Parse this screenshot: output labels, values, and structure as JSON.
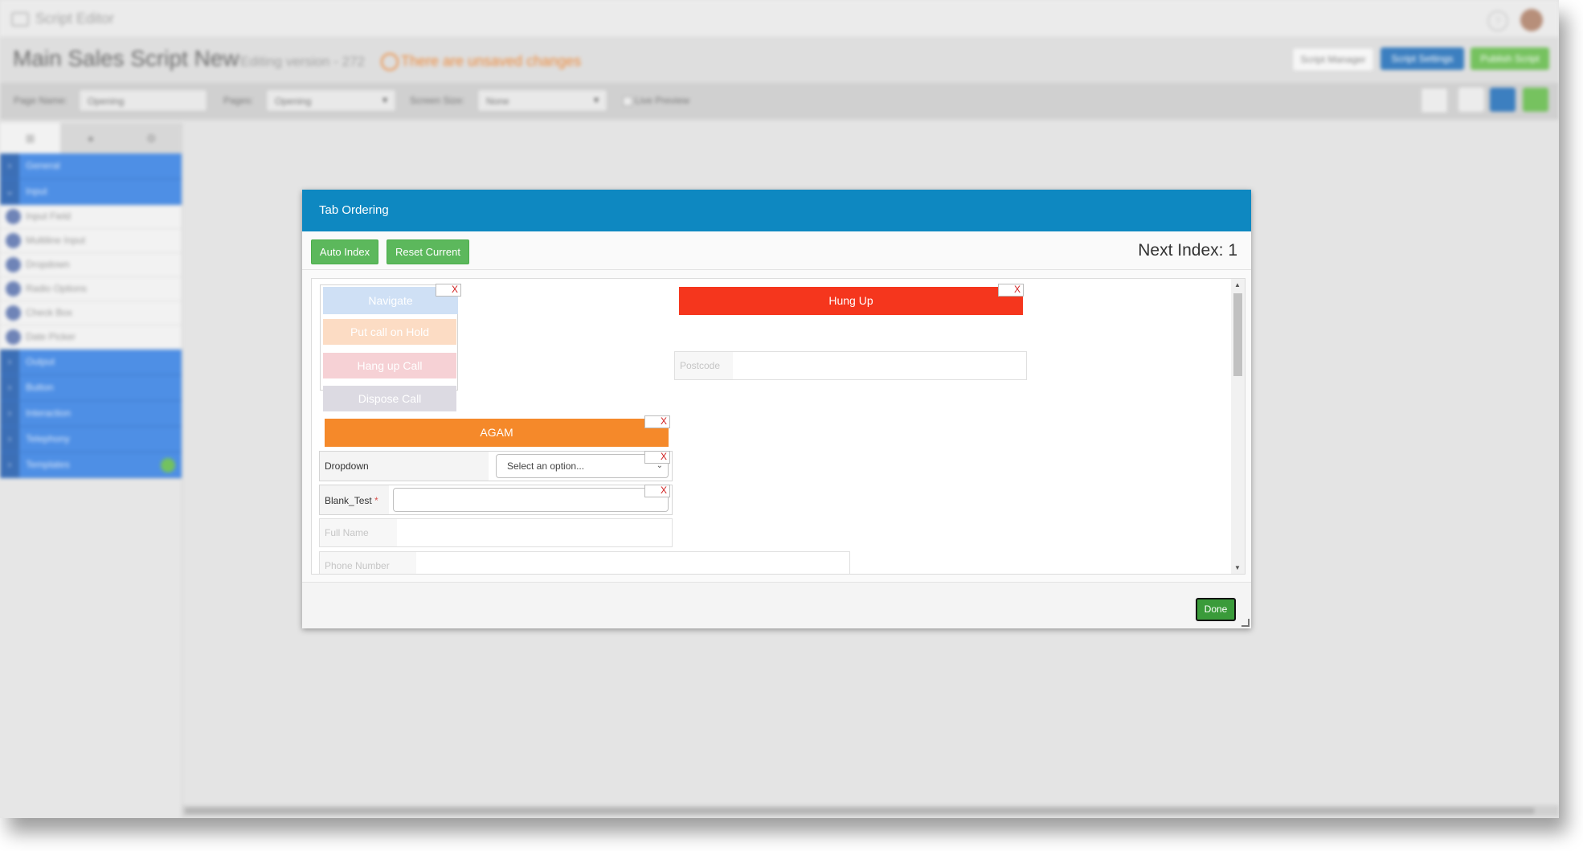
{
  "app": {
    "title": "Script Editor",
    "script_name": "Main Sales Script New",
    "editing_version": "Editing version - 272",
    "unsaved_text": "There are unsaved changes",
    "buttons": {
      "manager": "Script Manager",
      "settings": "Script Settings",
      "publish": "Publish Script"
    }
  },
  "toolbar": {
    "page_name_label": "Page Name:",
    "page_name_value": "Opening",
    "pages_label": "Pages:",
    "pages_value": "Opening",
    "screen_size_label": "Screen Size:",
    "screen_size_value": "None",
    "live_preview_label": "Live Preview"
  },
  "sidebar": {
    "categories": [
      {
        "label": "General"
      },
      {
        "label": "Input"
      },
      {
        "label": "Output"
      },
      {
        "label": "Button"
      },
      {
        "label": "Interaction"
      },
      {
        "label": "Telephony"
      },
      {
        "label": "Templates"
      }
    ],
    "input_items": [
      {
        "label": "Input Field"
      },
      {
        "label": "Multiline Input"
      },
      {
        "label": "Dropdown"
      },
      {
        "label": "Radio Options"
      },
      {
        "label": "Check Box"
      },
      {
        "label": "Date Picker"
      }
    ]
  },
  "modal": {
    "title": "Tab Ordering",
    "auto_index": "Auto Index",
    "reset_current": "Reset Current",
    "next_index": "Next Index: 1",
    "done": "Done",
    "x_mark": "X",
    "elements": {
      "navigate": "Navigate",
      "hold": "Put call on Hold",
      "hangup_call": "Hang up Call",
      "dispose": "Dispose Call",
      "hung_up": "Hung Up",
      "agam": "AGAM",
      "postcode": "Postcode",
      "dropdown_label": "Dropdown",
      "dropdown_placeholder": "Select an option...",
      "blank_test": "Blank_Test",
      "required_mark": "*",
      "full_name": "Full Name",
      "phone_number": "Phone Number"
    }
  },
  "colors": {
    "modal_header": "#0e88c1",
    "green": "#5cb85c",
    "hung_up_red": "#f5361d",
    "agam_orange": "#f5892a",
    "sidebar_blue": "#4e8fe5"
  }
}
